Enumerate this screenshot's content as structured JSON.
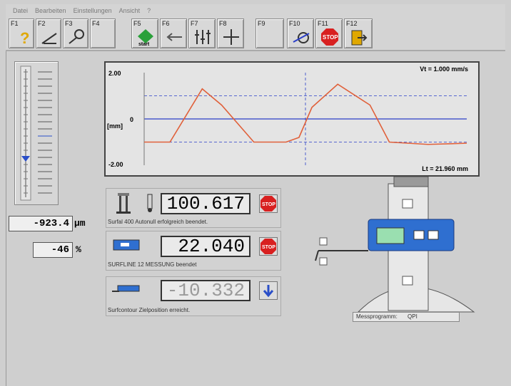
{
  "menu": [
    "Datei",
    "Bearbeiten",
    "Einstellungen",
    "Ansicht",
    "?"
  ],
  "fkeys": [
    {
      "key": "F1",
      "icon": "help-icon"
    },
    {
      "key": "F2",
      "icon": "measure-setup-icon"
    },
    {
      "key": "F3",
      "icon": "probe-icon"
    },
    {
      "key": "F4",
      "icon": ""
    },
    {
      "key": "F5",
      "icon": "start-icon",
      "text": "start"
    },
    {
      "key": "F6",
      "icon": "return-icon"
    },
    {
      "key": "F7",
      "icon": "adjust-icon"
    },
    {
      "key": "F8",
      "icon": "align-icon"
    },
    {
      "key": "F9",
      "icon": ""
    },
    {
      "key": "F10",
      "icon": "traverse-icon"
    },
    {
      "key": "F11",
      "icon": "stop-icon",
      "text": "STOP"
    },
    {
      "key": "F12",
      "icon": "exit-icon"
    }
  ],
  "chart_data": {
    "type": "line",
    "y_top_label": "2.00",
    "y_zero_label": "0",
    "y_unit_label": "[mm]",
    "y_bottom_label": "-2.00",
    "ylim": [
      -2.0,
      2.0
    ],
    "speed_label": "Vt = 1.000 mm/s",
    "length_label": "Lt = 21.960 mm",
    "series": [
      {
        "x": [
          0,
          8,
          18,
          24,
          34,
          44,
          48,
          52,
          60,
          70,
          76,
          88,
          100
        ],
        "values": [
          -1.0,
          -1.0,
          1.3,
          0.6,
          -1.0,
          -1.0,
          -0.8,
          0.5,
          1.5,
          0.6,
          -1.0,
          -1.1,
          -1.05
        ]
      }
    ]
  },
  "readouts": {
    "deviation": "-923.4",
    "deviation_unit": "µm",
    "percent": "-46",
    "percent_unit": "%"
  },
  "panels": [
    {
      "value": "100.617",
      "caption": "Surfal 400  Autonull erfolgreich beendet.",
      "button": "STOP"
    },
    {
      "value": "22.040",
      "caption": "SURFLINE 12  MESSUNG beendet",
      "button": "STOP"
    },
    {
      "value": "-10.332",
      "caption": "Surfcontour  Zielposition erreicht.",
      "button": "down-arrow"
    }
  ],
  "program": {
    "label": "Messprogramm:",
    "value": "QPI"
  },
  "colors": {
    "curve": "#e0603a",
    "grid_blue": "#2a3ec8",
    "stop_red": "#d82020",
    "machine_blue": "#2f6fd0"
  }
}
